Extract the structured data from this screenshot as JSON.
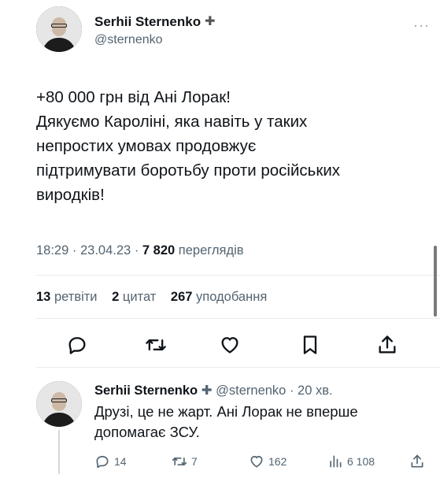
{
  "tweet": {
    "author": {
      "display_name": "Serhii Sternenko",
      "verified_glyph": "✚",
      "handle": "@sternenko"
    },
    "more_glyph": "···",
    "text_lines": [
      "+80 000 грн від Ані Лорак!",
      "Дякуємо Кароліні, яка навіть у таких",
      "непростих умовах продовжує",
      "підтримувати боротьбу проти російських",
      "виродків!"
    ],
    "time": "18:29",
    "date": "23.04.23",
    "views_count": "7 820",
    "views_label": "переглядів",
    "retweets_count": "13",
    "retweets_label": "ретвіти",
    "quotes_count": "2",
    "quotes_label": "цитат",
    "likes_count": "267",
    "likes_label": "уподобання",
    "actions": [
      "reply-icon",
      "retweet-icon",
      "like-icon",
      "bookmark-icon",
      "share-icon"
    ]
  },
  "reply": {
    "display_name": "Serhii Sternenko",
    "verified_glyph": "✚",
    "handle": "@sternenko",
    "age": "20 хв.",
    "text_lines": [
      "Друзі, це не жарт. Ані Лорак не вперше",
      "допомагає ЗСУ."
    ],
    "replies": "14",
    "retweets": "7",
    "likes": "162",
    "views": "6 108"
  }
}
